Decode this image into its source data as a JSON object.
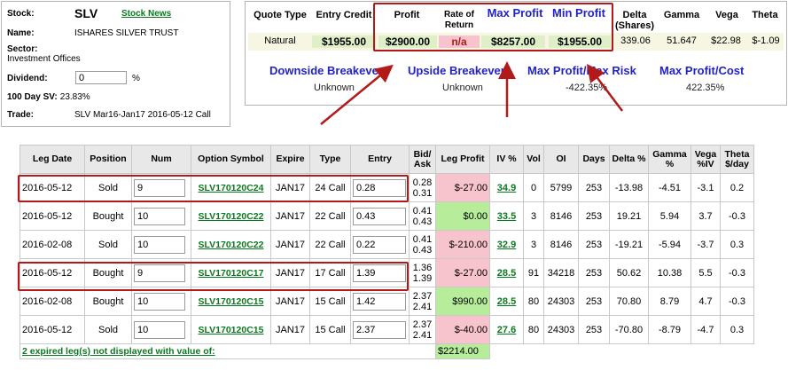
{
  "stock": {
    "stock_label": "Stock:",
    "symbol": "SLV",
    "news_link": "Stock News",
    "name_label": "Name:",
    "name": "ISHARES SILVER TRUST",
    "sector_label": "Sector:",
    "sector": "Investment Offices",
    "dividend_label": "Dividend:",
    "dividend_value": "0",
    "dividend_unit": "%",
    "sv_label": "100 Day SV:",
    "sv_value": "23.83%",
    "trade_label": "Trade:",
    "trade_value": "SLV Mar16-Jan17 2016-05-12 Call"
  },
  "summary": {
    "headers": {
      "quote_type": "Quote Type",
      "entry_credit": "Entry Credit",
      "profit": "Profit",
      "ror": "Rate of Return",
      "max_profit": "Max Profit",
      "min_profit": "Min Profit",
      "delta": "Delta (Shares)",
      "gamma": "Gamma",
      "vega": "Vega",
      "theta": "Theta"
    },
    "values": {
      "quote_type": "Natural",
      "entry_credit": "$1955.00",
      "profit": "$2900.00",
      "ror": "n/a",
      "max_profit": "$8257.00",
      "min_profit": "$1955.00",
      "delta": "339.06",
      "gamma": "51.647",
      "vega": "$22.98",
      "theta": "$-1.09"
    },
    "links": {
      "downside": "Downside Breakeven",
      "upside": "Upside Breakeven",
      "maxprofit_risk": "Max Profit/Max Risk",
      "maxprofit_cost": "Max Profit/Cost"
    },
    "link_values": {
      "downside": "Unknown",
      "upside": "Unknown",
      "maxprofit_risk": "-422.35%",
      "maxprofit_cost": "422.35%"
    }
  },
  "legs": {
    "headers": [
      "Leg Date",
      "Position",
      "Num",
      "Option Symbol",
      "Expire",
      "Type",
      "Entry",
      "Bid/ Ask",
      "Leg Profit",
      "IV %",
      "Vol",
      "OI",
      "Days",
      "Delta %",
      "Gamma %",
      "Vega %IV",
      "Theta $/day"
    ],
    "rows": [
      {
        "date": "2016-05-12",
        "position": "Sold",
        "num": "9",
        "symbol": "SLV170120C24",
        "expire": "JAN17",
        "type": "24 Call",
        "entry": "0.28",
        "bid": "0.28",
        "ask": "0.31",
        "profit": "$-27.00",
        "profit_sign": "neg",
        "iv": "34.9",
        "vol": "0",
        "oi": "5799",
        "days": "253",
        "delta": "-13.98",
        "gamma": "-4.51",
        "vega": "-3.1",
        "theta": "0.2"
      },
      {
        "date": "2016-05-12",
        "position": "Bought",
        "num": "10",
        "symbol": "SLV170120C22",
        "expire": "JAN17",
        "type": "22 Call",
        "entry": "0.43",
        "bid": "0.41",
        "ask": "0.43",
        "profit": "$0.00",
        "profit_sign": "pos",
        "iv": "33.5",
        "vol": "3",
        "oi": "8146",
        "days": "253",
        "delta": "19.21",
        "gamma": "5.94",
        "vega": "3.7",
        "theta": "-0.3"
      },
      {
        "date": "2016-02-08",
        "position": "Sold",
        "num": "10",
        "symbol": "SLV170120C22",
        "expire": "JAN17",
        "type": "22 Call",
        "entry": "0.22",
        "bid": "0.41",
        "ask": "0.43",
        "profit": "$-210.00",
        "profit_sign": "neg",
        "iv": "32.9",
        "vol": "3",
        "oi": "8146",
        "days": "253",
        "delta": "-19.21",
        "gamma": "-5.94",
        "vega": "-3.7",
        "theta": "0.3"
      },
      {
        "date": "2016-05-12",
        "position": "Bought",
        "num": "9",
        "symbol": "SLV170120C17",
        "expire": "JAN17",
        "type": "17 Call",
        "entry": "1.39",
        "bid": "1.36",
        "ask": "1.39",
        "profit": "$-27.00",
        "profit_sign": "neg",
        "iv": "28.5",
        "vol": "91",
        "oi": "34218",
        "days": "253",
        "delta": "50.62",
        "gamma": "10.38",
        "vega": "5.5",
        "theta": "-0.3"
      },
      {
        "date": "2016-02-08",
        "position": "Bought",
        "num": "10",
        "symbol": "SLV170120C15",
        "expire": "JAN17",
        "type": "15 Call",
        "entry": "1.42",
        "bid": "2.37",
        "ask": "2.41",
        "profit": "$990.00",
        "profit_sign": "pos",
        "iv": "28.5",
        "vol": "80",
        "oi": "24303",
        "days": "253",
        "delta": "70.80",
        "gamma": "8.79",
        "vega": "4.7",
        "theta": "-0.3"
      },
      {
        "date": "2016-05-12",
        "position": "Sold",
        "num": "10",
        "symbol": "SLV170120C15",
        "expire": "JAN17",
        "type": "15 Call",
        "entry": "2.37",
        "bid": "2.37",
        "ask": "2.41",
        "profit": "$-40.00",
        "profit_sign": "neg",
        "iv": "27.6",
        "vol": "80",
        "oi": "24303",
        "days": "253",
        "delta": "-70.80",
        "gamma": "-8.79",
        "vega": "-4.7",
        "theta": "0.3"
      }
    ],
    "footer": {
      "expired_text": "2 expired leg(s) not displayed with value of:",
      "expired_value": "$2214.00"
    }
  },
  "colors": {
    "annotation_red": "#b21a1a",
    "link_green": "#0a7a1f",
    "header_blue": "#2222cc",
    "loss_pink": "#f7c3cc",
    "gain_green": "#b6ec9a"
  }
}
